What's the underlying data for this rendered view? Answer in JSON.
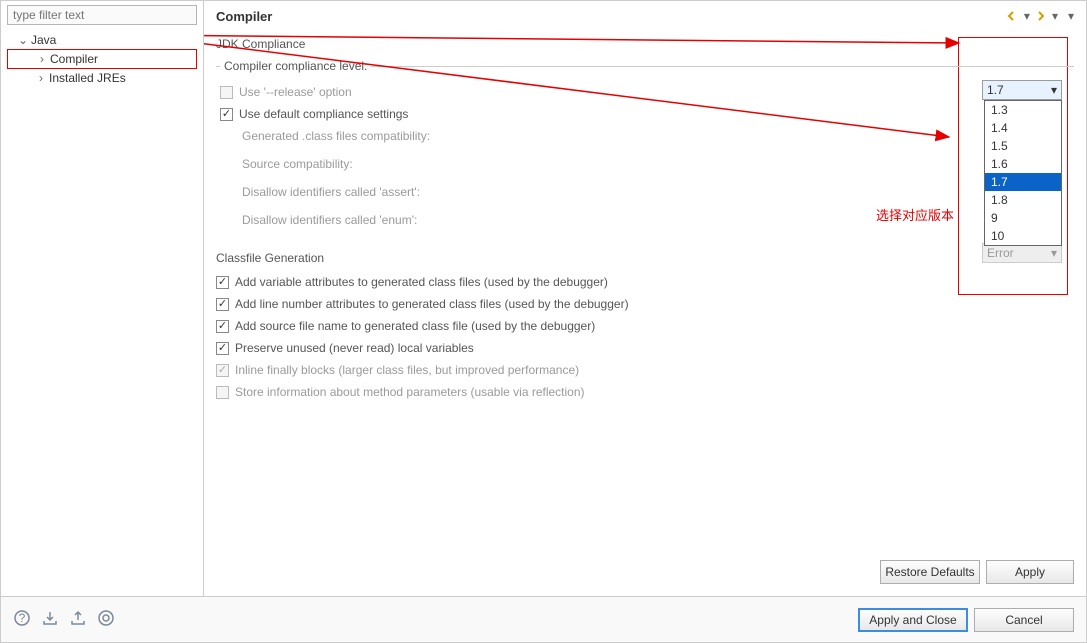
{
  "filter_placeholder": "type filter text",
  "tree": {
    "java": "Java",
    "compiler": "Compiler",
    "installed_jres": "Installed JREs"
  },
  "page_title": "Compiler",
  "jdk_section": "JDK Compliance",
  "compliance_label": "Compiler compliance level:",
  "compliance_value": "1.7",
  "dropdown_options": [
    "1.3",
    "1.4",
    "1.5",
    "1.6",
    "1.7",
    "1.8",
    "9",
    "10"
  ],
  "dropdown_selected": "1.7",
  "use_release": "Use '--release' option",
  "use_default": "Use default compliance settings",
  "gen_class": "Generated .class files compatibility:",
  "src_compat": "Source compatibility:",
  "disallow_assert": "Disallow identifiers called 'assert':",
  "disallow_enum": "Disallow identifiers called 'enum':",
  "error_value": "Error",
  "classfile_section": "Classfile Generation",
  "cf_var": "Add variable attributes to generated class files (used by the debugger)",
  "cf_line": "Add line number attributes to generated class files (used by the debugger)",
  "cf_src": "Add source file name to generated class file (used by the debugger)",
  "cf_preserve": "Preserve unused (never read) local variables",
  "cf_inline": "Inline finally blocks (larger class files, but improved performance)",
  "cf_store": "Store information about method parameters (usable via reflection)",
  "annotation_text": "选择对应版本",
  "btn_restore": "Restore Defaults",
  "btn_apply": "Apply",
  "btn_apply_close": "Apply and Close",
  "btn_cancel": "Cancel"
}
